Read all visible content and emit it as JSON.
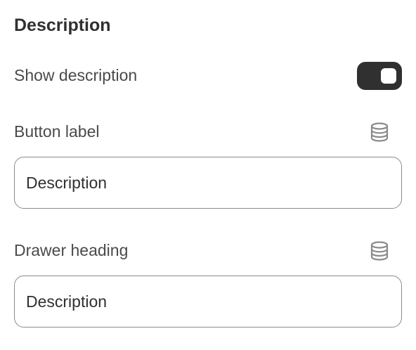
{
  "section": {
    "title": "Description"
  },
  "show_description": {
    "label": "Show description",
    "enabled": true
  },
  "button_label": {
    "label": "Button label",
    "value": "Description",
    "icon": "database-icon"
  },
  "drawer_heading": {
    "label": "Drawer heading",
    "value": "Description",
    "icon": "database-icon"
  },
  "colors": {
    "toggle_on": "#303030",
    "text": "#303030",
    "icon": "#8a8a8a",
    "border": "#8a8a8a"
  }
}
